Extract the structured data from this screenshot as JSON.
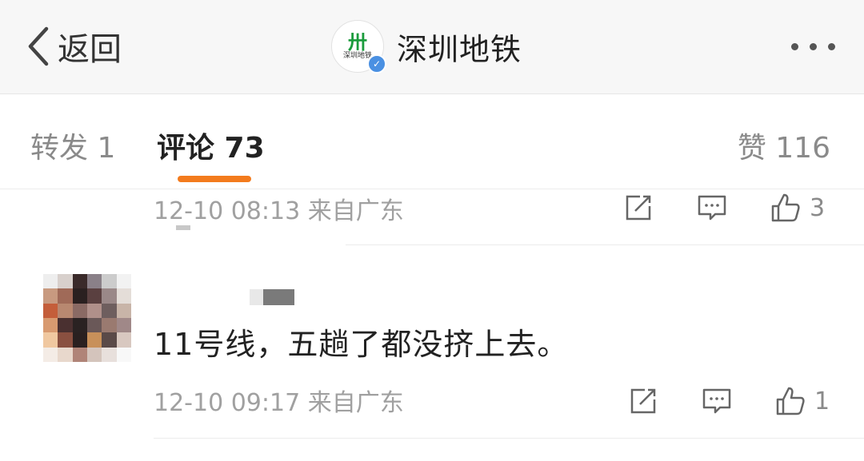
{
  "header": {
    "back_label": "返回",
    "account_name": "深圳地铁",
    "logo_mark": "卅",
    "logo_text": "深圳地铁",
    "verified_mark": "✓"
  },
  "tabs": {
    "repost": "转发 1",
    "comments": "评论 73",
    "likes": "赞 116"
  },
  "comments": [
    {
      "time": "12-10 08:13 来自广东",
      "like_count": "3"
    },
    {
      "text": "11号线，五趟了都没挤上去。",
      "time": "12-10 09:17 来自广东",
      "like_count": "1"
    }
  ],
  "colors": {
    "accent": "#f37b1d",
    "logo_green": "#1a9b3c",
    "verified_blue": "#4a90e2"
  },
  "icons": [
    "chevron-left-icon",
    "more-icon",
    "repost-icon",
    "comment-icon",
    "like-icon"
  ]
}
